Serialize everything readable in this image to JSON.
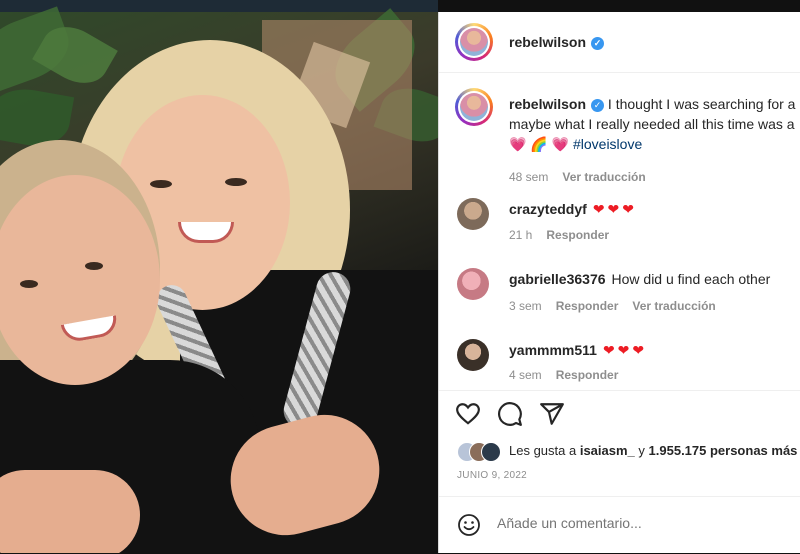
{
  "post": {
    "username": "rebelwilson",
    "verified_mark": "✓",
    "caption": {
      "username": "rebelwilson",
      "line1": "I thought I was searching for a",
      "line2": "maybe what I really needed all this time was a",
      "line3_emoji": "💗 🌈 💗",
      "hashtag": "#loveislove",
      "age": "48 sem",
      "translate": "Ver traducción"
    }
  },
  "comments": [
    {
      "username": "crazyteddyf",
      "text": "❤❤❤",
      "age": "21 h",
      "reply": "Responder",
      "translate": ""
    },
    {
      "username": "gabrielle36376",
      "text": "How did u find each other",
      "age": "3 sem",
      "reply": "Responder",
      "translate": "Ver traducción"
    },
    {
      "username": "yammmm511",
      "text": "❤❤❤",
      "age": "4 sem",
      "reply": "Responder",
      "translate": ""
    }
  ],
  "actions": {
    "like_icon": "heart-outline-icon",
    "comment_icon": "speech-bubble-icon",
    "share_icon": "paper-plane-icon"
  },
  "likes": {
    "prefix": "Les gusta a",
    "user": "isaiasm_",
    "connector": "y",
    "count": "1.955.175 personas más"
  },
  "date": "JUNIO 9, 2022",
  "add_comment": {
    "placeholder": "Añade un comentario...",
    "icon": "smiley-icon"
  },
  "colors": {
    "verified": "#3897f0",
    "hashtag": "#00376b",
    "heart": "#ed1c24",
    "muted": "#8e8e8e"
  }
}
